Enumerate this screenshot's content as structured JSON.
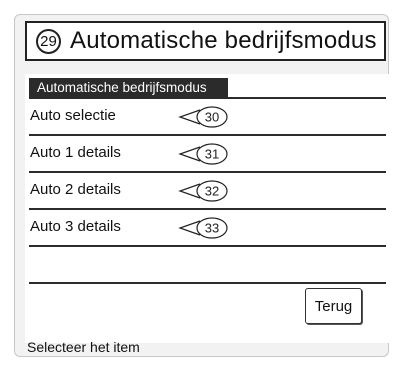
{
  "title": {
    "number": "29",
    "text": "Automatische bedrijfsmodus"
  },
  "tab": {
    "label": "Automatische bedrijfsmodus"
  },
  "menu_items": [
    {
      "label": "Auto selectie",
      "callout": "30"
    },
    {
      "label": "Auto 1 details",
      "callout": "31"
    },
    {
      "label": "Auto 2 details",
      "callout": "32"
    },
    {
      "label": "Auto 3 details",
      "callout": "33"
    }
  ],
  "back_button": {
    "label": "Terug"
  },
  "status": {
    "text": "Selecteer het item"
  }
}
